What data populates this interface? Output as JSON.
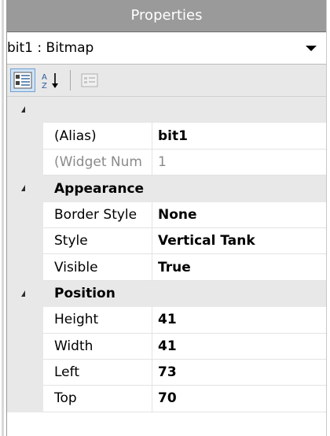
{
  "panel": {
    "title": "Properties",
    "object_selector": "bit1 : Bitmap"
  },
  "toolbar": {
    "buttons": [
      {
        "name": "categorized",
        "icon": "categorized-icon",
        "active": true
      },
      {
        "name": "alphabetical",
        "icon": "sort-az-icon",
        "active": false
      },
      {
        "name": "property-pages",
        "icon": "property-pages-icon",
        "active": false
      }
    ]
  },
  "grid": {
    "groups": [
      {
        "label": "",
        "rows": [
          {
            "name": "(Alias)",
            "value": "bit1",
            "disabled": false
          },
          {
            "name": "(Widget Num",
            "value": "1",
            "disabled": true
          }
        ]
      },
      {
        "label": "Appearance",
        "rows": [
          {
            "name": "Border Style",
            "value": "None",
            "disabled": false
          },
          {
            "name": "Style",
            "value": "Vertical Tank",
            "disabled": false
          },
          {
            "name": "Visible",
            "value": "True",
            "disabled": false
          }
        ]
      },
      {
        "label": "Position",
        "rows": [
          {
            "name": "Height",
            "value": "41",
            "disabled": false
          },
          {
            "name": "Width",
            "value": "41",
            "disabled": false
          },
          {
            "name": "Left",
            "value": "73",
            "disabled": false
          },
          {
            "name": "Top",
            "value": "70",
            "disabled": false
          }
        ]
      }
    ]
  },
  "colors": {
    "title_bg": "#9a9a9a",
    "gutter_bg": "#e8e8e8",
    "active_button_bg": "#cfe3f7"
  }
}
